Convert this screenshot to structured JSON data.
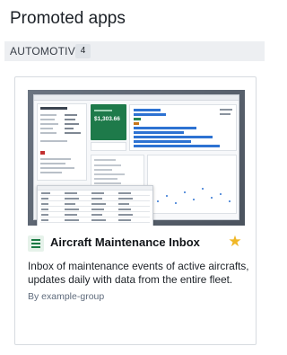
{
  "page": {
    "title": "Promoted apps"
  },
  "category": {
    "label": "AUTOMOTIVE",
    "count": "4"
  },
  "app": {
    "title": "Aircraft Maintenance Inbox",
    "description": "Inbox of maintenance events of active aircrafts, updates daily with data from the entire fleet.",
    "author": "By example-group",
    "icon": "spreadsheet-icon",
    "favorite_icon": "star-icon",
    "preview": {
      "widget_title": "Energy Sold, 12Incl",
      "price": "$1,303.66"
    }
  },
  "colors": {
    "accent_green": "#1e7a4a",
    "star": "#f0b726",
    "bar_blue": "#2d72d2",
    "bar_green": "#238551"
  }
}
